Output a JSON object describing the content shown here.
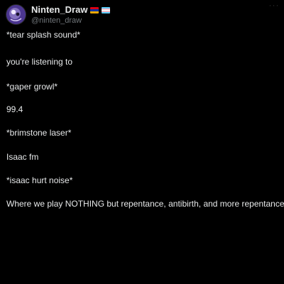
{
  "author": {
    "display_name": "Ninten_Draw",
    "handle": "@ninten_draw",
    "avatar": "avatar-icon",
    "flags": [
      "armenia-flag",
      "transgender-flag"
    ]
  },
  "more_menu": "more-options-icon",
  "tweet_lines": [
    "*tear splash sound*",
    "you're listening to",
    "*gaper growl*",
    "99.4",
    "*brimstone laser*",
    "Isaac fm",
    "*isaac hurt noise*",
    "Where we play NOTHING but repentance, antibirth, and more repentance"
  ]
}
